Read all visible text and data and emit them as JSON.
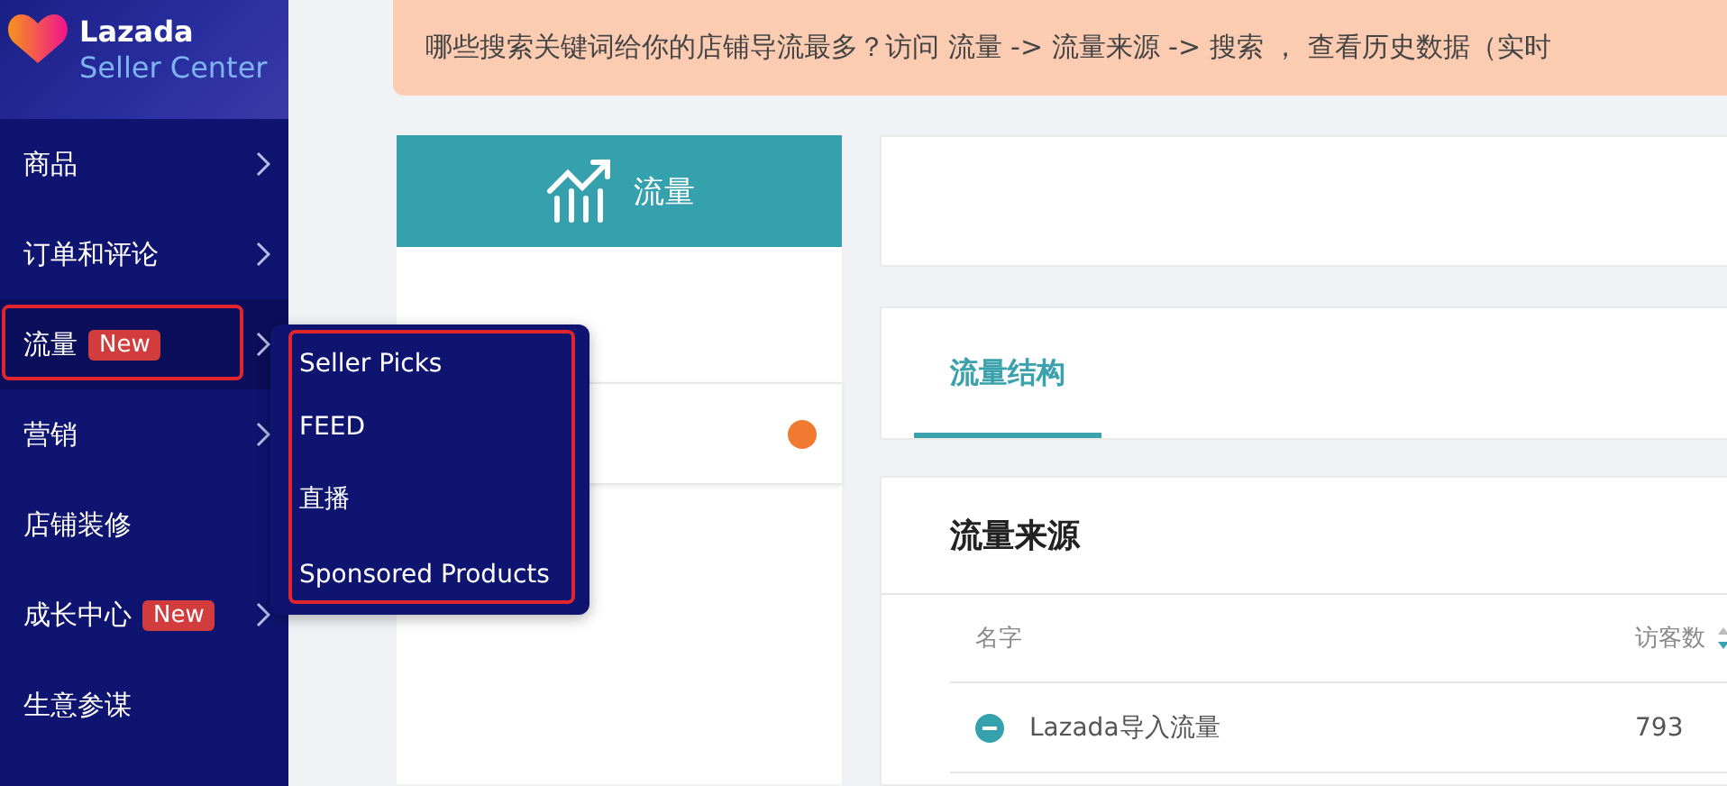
{
  "logo": {
    "brand": "Lazada",
    "product": "Seller Center"
  },
  "sidebar": {
    "items": [
      {
        "label": "商品",
        "has_submenu": true,
        "highlighted": false
      },
      {
        "label": "订单和评论",
        "has_submenu": true,
        "highlighted": false
      },
      {
        "label": "流量",
        "badge": "New",
        "has_submenu": true,
        "highlighted": true
      },
      {
        "label": "营销",
        "has_submenu": true,
        "highlighted": false
      },
      {
        "label": "店铺装修",
        "has_submenu": false,
        "highlighted": false
      },
      {
        "label": "成长中心",
        "badge": "New",
        "has_submenu": true,
        "highlighted": false
      },
      {
        "label": "生意参谋",
        "has_submenu": false,
        "highlighted": false
      }
    ]
  },
  "flyout": {
    "highlighted": true,
    "items": [
      "Seller Picks",
      "FEED",
      "直播",
      "Sponsored Products"
    ]
  },
  "banner": {
    "text": "哪些搜索关键词给你的店铺导流最多？访问 流量 -> 流量来源 -> 搜索 ， 查看历史数据（实时"
  },
  "traffic_card": {
    "title": "流量",
    "rows": [
      {
        "color": "#ef7a30"
      }
    ]
  },
  "tabs": [
    {
      "label": "流量结构",
      "selected": true
    }
  ],
  "traffic_sources": {
    "title": "流量来源",
    "columns": [
      "名字",
      "访客数"
    ],
    "rows": [
      {
        "name": "Lazada导入流量",
        "visitors": "793",
        "expanded": true
      }
    ]
  }
}
